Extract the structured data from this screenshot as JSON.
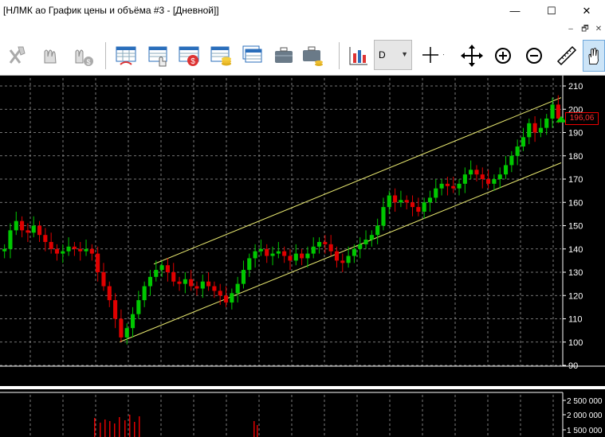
{
  "window": {
    "title": "[НЛМК ао График цены и объёма #3 - [Дневной]]",
    "minimize_glyph": "—",
    "maximize_glyph": "☐",
    "close_glyph": "✕"
  },
  "mdi": {
    "minimize_glyph": "–",
    "restore_glyph": "🗗",
    "close_glyph": "✕"
  },
  "toolbar": {
    "timeframe": "D",
    "icons": [
      "cancel-order-icon",
      "modify-order-icon",
      "cancel-all-icon",
      "trade-table-icon",
      "orders-table-icon",
      "stop-orders-icon",
      "quotes-table-icon",
      "coins-table-icon",
      "portfolio-icon",
      "briefcase-icon",
      "briefcase-coins-icon",
      "chart-bars-icon",
      "crosshair-icon",
      "move-icon",
      "zoom-in-icon",
      "zoom-out-icon",
      "ruler-icon",
      "hand-icon"
    ]
  },
  "colors": {
    "up": "#00c800",
    "down": "#e00000",
    "channel": "#e8e870",
    "grid": "#9a9a9a",
    "axis_text": "#ffffff",
    "price_tag": "#ff3030"
  },
  "chart_data": {
    "type": "candlestick",
    "price_axis": {
      "ticks": [
        "210",
        "200",
        "190",
        "180",
        "170",
        "160",
        "150",
        "140",
        "130",
        "120",
        "110",
        "100",
        "90"
      ],
      "ylim": [
        89,
        213
      ]
    },
    "current_price": "196,06",
    "series": [
      {
        "name": "",
        "closes": [
          140,
          148,
          152,
          148,
          147,
          150,
          146,
          143,
          140,
          138,
          139,
          141,
          140,
          139,
          140,
          138,
          130,
          124,
          118,
          110,
          102,
          106,
          112,
          118,
          124,
          128,
          131,
          133,
          130,
          126,
          125,
          127,
          124,
          123,
          126,
          124,
          122,
          120,
          117,
          121,
          125,
          131,
          136,
          139,
          140,
          137,
          138,
          139,
          137,
          135,
          138,
          136,
          138,
          141,
          143,
          142,
          139,
          135,
          134,
          137,
          140,
          142,
          144,
          146,
          150,
          158,
          163,
          160,
          161,
          160,
          158,
          156,
          160,
          162,
          166,
          168,
          167,
          166,
          168,
          172,
          174,
          172,
          170,
          168,
          170,
          172,
          176,
          180,
          184,
          188,
          194,
          190,
          192,
          196,
          202,
          196
        ]
      }
    ],
    "volume_axis": {
      "ticks": [
        "2 500 000",
        "2 000 000",
        "1 500 000"
      ]
    },
    "channel": {
      "upper": [
        [
          0.0,
          133.5
        ],
        [
          1.0,
          205.0
        ]
      ],
      "lower": [
        [
          0.0,
          100.0
        ],
        [
          1.0,
          177.0
        ]
      ]
    }
  }
}
